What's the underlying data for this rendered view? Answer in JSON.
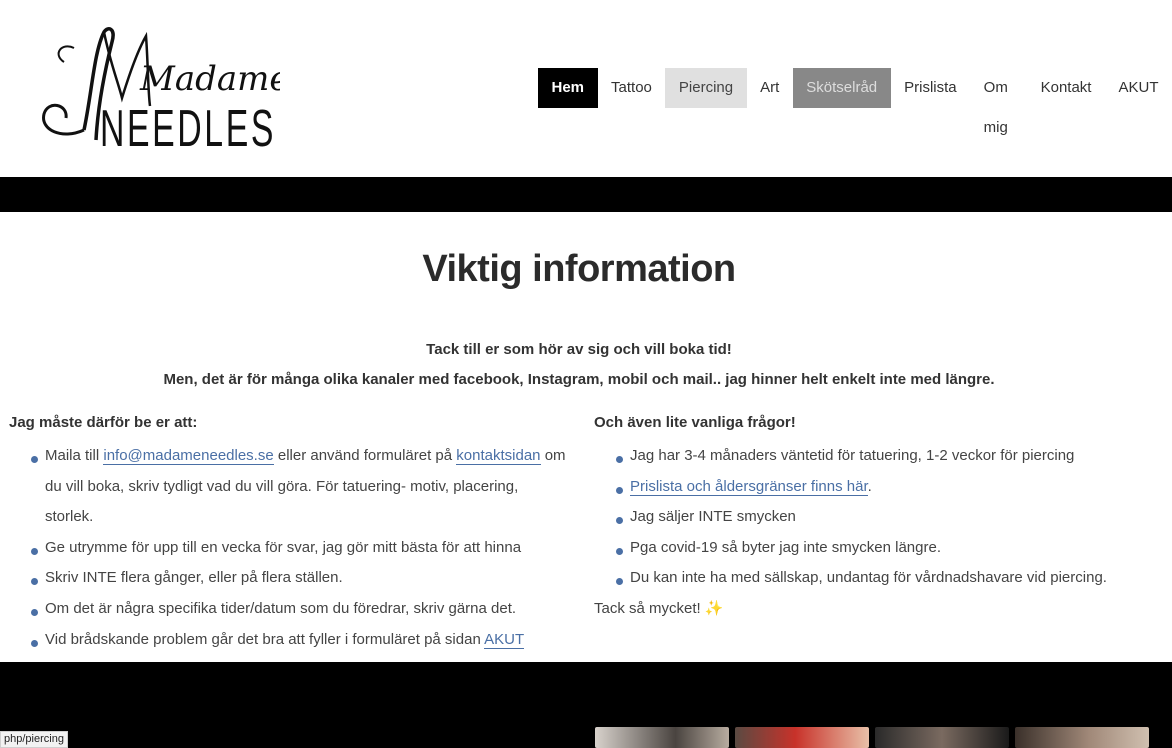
{
  "logo": {
    "line1": "Madame",
    "line2": "NEEDLES"
  },
  "nav": [
    {
      "label": "Hem",
      "state": "active"
    },
    {
      "label": "Tattoo",
      "state": "normal"
    },
    {
      "label": "Piercing",
      "state": "hovered"
    },
    {
      "label": "Art",
      "state": "normal"
    },
    {
      "label": "Skötselråd",
      "state": "grey"
    },
    {
      "label": "Prislista",
      "state": "normal"
    },
    {
      "label": "Om mig",
      "state": "normal"
    },
    {
      "label": "Kontakt",
      "state": "normal"
    },
    {
      "label": "AKUT",
      "state": "normal"
    }
  ],
  "content": {
    "title": "Viktig information",
    "intro_line1": "Tack till er som hör av sig och vill boka tid!",
    "intro_line2": "Men, det är för många olika kanaler med facebook, Instagram, mobil och mail.. jag hinner helt enkelt inte med längre.",
    "left": {
      "heading": "Jag måste därför be er att:",
      "item1_pre": "Maila till ",
      "item1_email": "info@madameneedles.se",
      "item1_mid": " eller använd formuläret på ",
      "item1_link": "kontaktsidan",
      "item1_post": " om du vill boka, skriv tydligt vad du vill göra. För tatuering- motiv, placering, storlek.",
      "item2": "Ge utrymme för upp till en vecka för svar, jag gör mitt bästa för att hinna",
      "item3": "Skriv INTE flera gånger, eller på flera ställen.",
      "item4": "Om det är några specifika tider/datum som du föredrar, skriv gärna det.",
      "item5_pre": "Vid brådskande problem går det bra att fyller i formuläret på sidan ",
      "item5_link": "AKUT"
    },
    "right": {
      "heading": "Och även lite vanliga frågor!",
      "item1": "Jag har 3-4 månaders väntetid för tatuering, 1-2 veckor för piercing",
      "item2_link": "Prislista och åldersgränser finns här",
      "item2_post": ".",
      "item3": "Jag säljer INTE smycken",
      "item4": "Pga covid-19 så byter jag inte smycken längre.",
      "item5": "Du kan inte ha med sällskap, undantag för vårdnadshavare vid piercing.",
      "thanks": "Tack så mycket!",
      "sparkle": "✨"
    }
  },
  "status_url": "php/piercing",
  "colors": {
    "link": "#4a6fa5",
    "nav_active_bg": "#000000",
    "band": "#000000"
  }
}
